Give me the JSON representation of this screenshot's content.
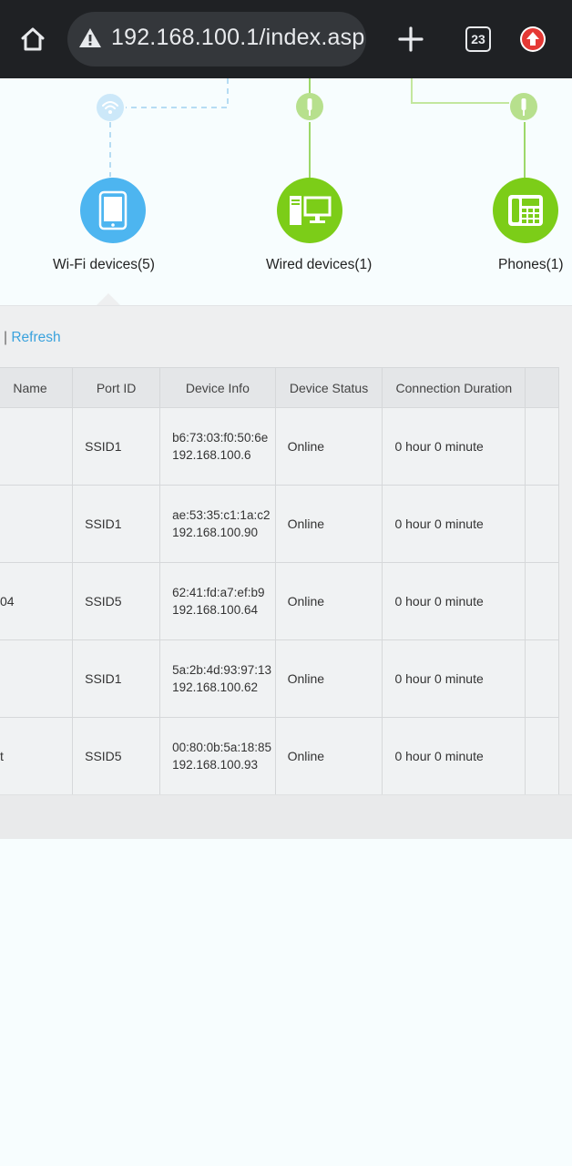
{
  "browser": {
    "url": "192.168.100.1/index.asp",
    "tab_count": "23"
  },
  "topology": {
    "wifi_label": "Wi-Fi devices(5)",
    "wired_label": "Wired devices(1)",
    "phones_label": "Phones(1)",
    "colors": {
      "wifi": "#4db5f0",
      "wired": "#7ccd18",
      "phones": "#7ccd18"
    }
  },
  "actions": {
    "separator": "|",
    "refresh": "Refresh"
  },
  "table": {
    "headers": [
      "Name",
      "Port ID",
      "Device Info",
      "Device Status",
      "Connection Duration"
    ],
    "rows": [
      {
        "name": "",
        "port": "SSID1",
        "mac": "b6:73:03:f0:50:6e",
        "ip": "192.168.100.6",
        "status": "Online",
        "duration": "0 hour 0 minute"
      },
      {
        "name": "",
        "port": "SSID1",
        "mac": "ae:53:35:c1:1a:c2",
        "ip": "192.168.100.90",
        "status": "Online",
        "duration": "0 hour 0 minute"
      },
      {
        "name": "04",
        "port": "SSID5",
        "mac": "62:41:fd:a7:ef:b9",
        "ip": "192.168.100.64",
        "status": "Online",
        "duration": "0 hour 0 minute"
      },
      {
        "name": "",
        "port": "SSID1",
        "mac": "5a:2b:4d:93:97:13",
        "ip": "192.168.100.62",
        "status": "Online",
        "duration": "0 hour 0 minute"
      },
      {
        "name": "t",
        "port": "SSID5",
        "mac": "00:80:0b:5a:18:85",
        "ip": "192.168.100.93",
        "status": "Online",
        "duration": "0 hour 0 minute"
      }
    ]
  }
}
